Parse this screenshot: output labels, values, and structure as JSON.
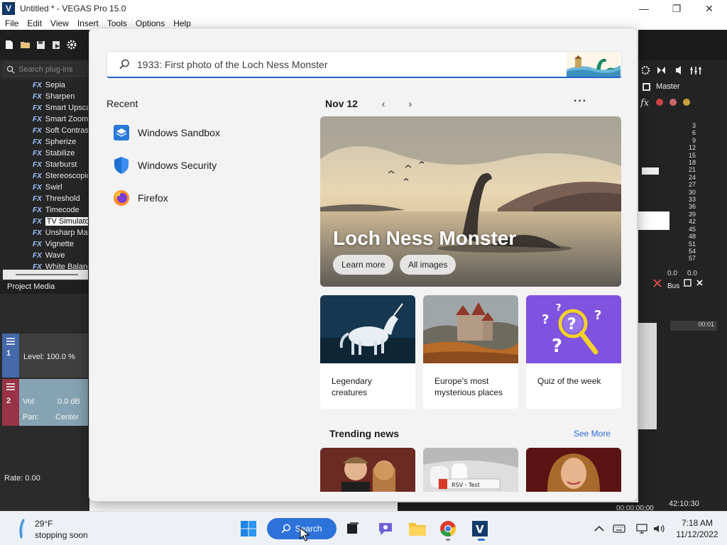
{
  "window": {
    "title": "Untitled * - VEGAS Pro 15.0",
    "logo_letter": "V",
    "controls": {
      "minimize": "—",
      "maximize": "❐",
      "close": "✕"
    }
  },
  "menu": [
    "File",
    "Edit",
    "View",
    "Insert",
    "Tools",
    "Options",
    "Help"
  ],
  "vegas": {
    "plugin_search_placeholder": "Search plug-ins",
    "fx_tag": "FX",
    "plugins": [
      "Sepia",
      "Sharpen",
      "Smart Upscale",
      "Smart Zoom",
      "Soft Contrast",
      "Spherize",
      "Stabilize",
      "Starburst",
      "Stereoscopic",
      "Swirl",
      "Threshold",
      "Timecode",
      "TV Simulator",
      "Unsharp Mask",
      "Vignette",
      "Wave",
      "White Balance"
    ],
    "selected_plugin": "TV Simulator",
    "project_media_tab": "Project Media",
    "track1": {
      "number": "1",
      "level": "Level: 100.0 %"
    },
    "track2": {
      "number": "2",
      "vol_label": "Vol:",
      "vol_value": "0.0 dB",
      "pan_label": "Pan:",
      "pan_value": "Center"
    },
    "rate": "Rate: 0.00",
    "master_label": "Master",
    "bus_label": "Bus",
    "meter_scale": [
      "3",
      "6",
      "9",
      "12",
      "15",
      "18",
      "21",
      "24",
      "27",
      "30",
      "33",
      "36",
      "39",
      "42",
      "45",
      "48",
      "51",
      "54",
      "57"
    ],
    "meter_bottom": [
      "0.0",
      "0.0"
    ],
    "timecode": "42:10:30",
    "small_timecode": "00:00:00;00",
    "ruler_time": "00:01"
  },
  "search": {
    "placeholder": "1933: First photo of the Loch Ness Monster",
    "recent_title": "Recent",
    "recent": [
      {
        "label": "Windows Sandbox",
        "icon": "windows-sandbox-icon"
      },
      {
        "label": "Windows Security",
        "icon": "shield-icon"
      },
      {
        "label": "Firefox",
        "icon": "firefox-icon"
      }
    ],
    "date": "Nov 12",
    "prev": "‹",
    "next": "›",
    "more": "···",
    "hero": {
      "title": "Loch Ness Monster",
      "learn_more": "Learn more",
      "all_images": "All images"
    },
    "cards": [
      {
        "caption": "Legendary creatures"
      },
      {
        "caption": "Europe's most mysterious places"
      },
      {
        "caption": "Quiz of the week"
      }
    ],
    "trending_title": "Trending news",
    "see_more": "See More",
    "news_label_2": "RSV - Test"
  },
  "taskbar": {
    "weather_temp": "29°F",
    "weather_desc": "stopping soon",
    "search_label": "Search",
    "clock_time": "7:18 AM",
    "clock_date": "11/12/2022"
  },
  "colors": {
    "accent": "#2d72d9",
    "search_underline": "#2563c9",
    "link": "#2b6cd6",
    "vegas_dark": "#2b2b2b"
  }
}
